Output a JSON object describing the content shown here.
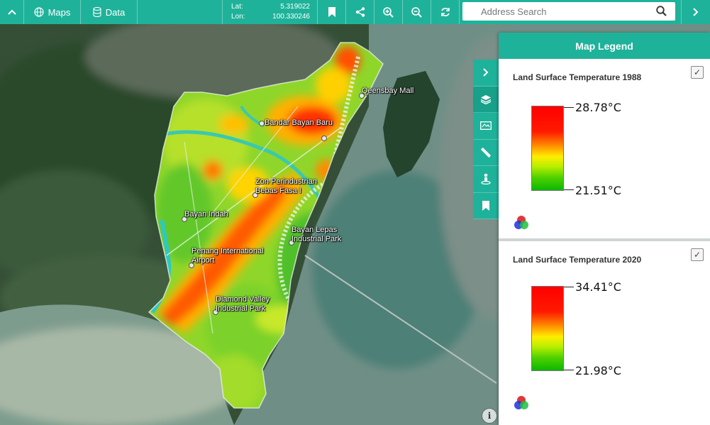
{
  "toolbar": {
    "maps_label": "Maps",
    "data_label": "Data",
    "lat_label": "Lat:",
    "lat_value": "5.319022",
    "lon_label": "Lon:",
    "lon_value": "100.330246",
    "search_placeholder": "Address Search",
    "icons": [
      "chevron-up-icon",
      "globe-icon",
      "database-icon",
      "bookmark-icon",
      "share-icon",
      "zoom-in-icon",
      "zoom-out-icon",
      "refresh-icon",
      "search-icon",
      "chevron-right-icon"
    ]
  },
  "sidetools": {
    "icons": [
      "chevron-right-icon",
      "layers-icon",
      "map-card-icon",
      "ruler-icon",
      "person-pin-icon",
      "bookmark-icon"
    ]
  },
  "legend": {
    "title": "Map Legend",
    "layers": [
      {
        "title": "Land Surface Temperature 1988",
        "max": "28.78°C",
        "min": "21.51°C",
        "checked": true
      },
      {
        "title": "Land Surface Temperature 2020",
        "max": "34.41°C",
        "min": "21.98°C",
        "checked": true
      }
    ],
    "ramp_colors": [
      "#ff0000",
      "#ff8000",
      "#ffee00",
      "#b7ee00",
      "#0cb800"
    ]
  },
  "map_labels": {
    "queensbay": "Qeensbay Mall",
    "bandar": "Bandar Bayan Baru",
    "zon": "Zon Perindustrian\nBebas Fasa I",
    "bayan_indah": "Bayan Indah",
    "bayan_lepas": "Bayan Lepas\nIndustrial Park",
    "airport": "Penang International\nAirport",
    "diamond": "Diamond Valley\nIndustrial Park"
  },
  "info_symbol": "i"
}
